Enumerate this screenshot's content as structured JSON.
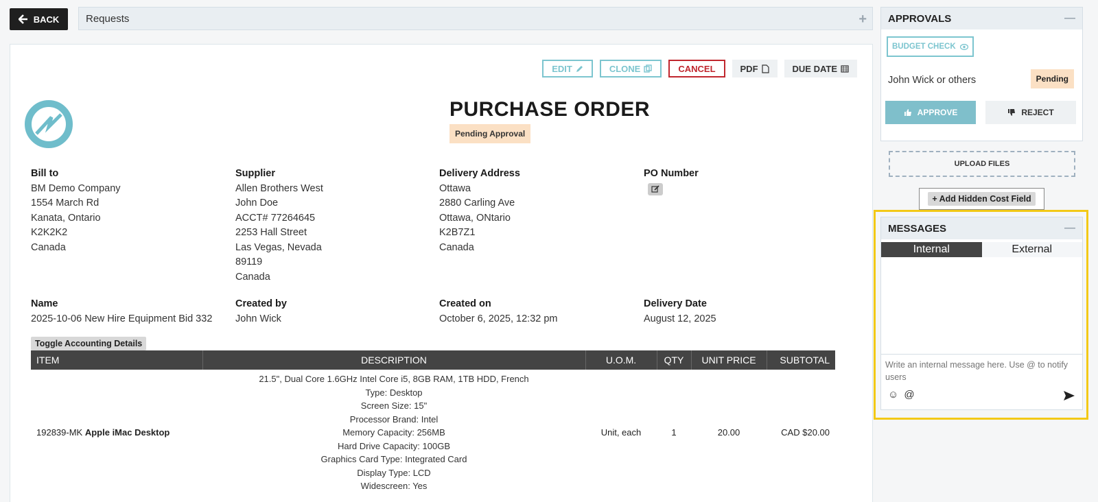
{
  "topbar": {
    "back_label": "BACK",
    "requests_label": "Requests",
    "add_icon": "plus-icon"
  },
  "actions": {
    "edit": "EDIT",
    "clone": "CLONE",
    "cancel": "CANCEL",
    "pdf": "PDF",
    "due_date": "DUE DATE"
  },
  "document": {
    "title": "PURCHASE ORDER",
    "status": "Pending Approval",
    "bill_to": {
      "heading": "Bill to",
      "lines": [
        "BM Demo Company",
        "1554 March Rd",
        "Kanata, Ontario",
        "K2K2K2",
        "Canada"
      ]
    },
    "supplier": {
      "heading": "Supplier",
      "lines": [
        "Allen Brothers West",
        "John Doe",
        "ACCT# 77264645",
        "2253 Hall Street",
        "Las Vegas, Nevada",
        "89119",
        "Canada"
      ]
    },
    "delivery": {
      "heading": "Delivery Address",
      "lines": [
        "Ottawa",
        "2880 Carling Ave",
        "Ottawa, ONtario",
        "K2B7Z1",
        "Canada"
      ]
    },
    "po_number": {
      "heading": "PO Number"
    },
    "name": {
      "heading": "Name",
      "value": "2025-10-06 New Hire Equipment Bid 332"
    },
    "created_by": {
      "heading": "Created by",
      "value": "John Wick"
    },
    "created_on": {
      "heading": "Created on",
      "value": "October 6, 2025, 12:32 pm"
    },
    "delivery_date": {
      "heading": "Delivery Date",
      "value": "August 12, 2025"
    },
    "toggle_accounting": "Toggle Accounting Details"
  },
  "items_table": {
    "headers": {
      "item": "ITEM",
      "description": "DESCRIPTION",
      "uom": "U.O.M.",
      "qty": "QTY",
      "unit_price": "UNIT PRICE",
      "subtotal": "SUBTOTAL"
    },
    "rows": [
      {
        "sku": "192839-MK",
        "name": "Apple iMac Desktop",
        "description": [
          "21.5\", Dual Core 1.6GHz Intel Core i5, 8GB RAM, 1TB HDD, French",
          "Type: Desktop",
          "Screen Size: 15\"",
          "Processor Brand: Intel",
          "Memory Capacity: 256MB",
          "Hard Drive Capacity: 100GB",
          "Graphics Card Type: Integrated Card",
          "Display Type: LCD",
          "Widescreen: Yes"
        ],
        "uom": "Unit, each",
        "qty": "1",
        "unit_price": "20.00",
        "subtotal": "CAD $20.00"
      }
    ]
  },
  "approvals": {
    "title": "APPROVALS",
    "budget_check": "BUDGET CHECK",
    "approver": "John Wick or others",
    "approver_status": "Pending",
    "approve": "APPROVE",
    "reject": "REJECT"
  },
  "upload_files": "UPLOAD FILES",
  "hidden_cost": "Add Hidden Cost Field",
  "messages": {
    "title": "MESSAGES",
    "tab_internal": "Internal",
    "tab_external": "External",
    "placeholder": "Write an internal message here. Use @ to notify users",
    "emoji": "☺",
    "mention": "@"
  },
  "colors": {
    "accent": "#7cc5cf",
    "danger": "#c0262d",
    "pending": "#fbe0c4",
    "highlight": "#f3c916",
    "header_dark": "#444444"
  }
}
